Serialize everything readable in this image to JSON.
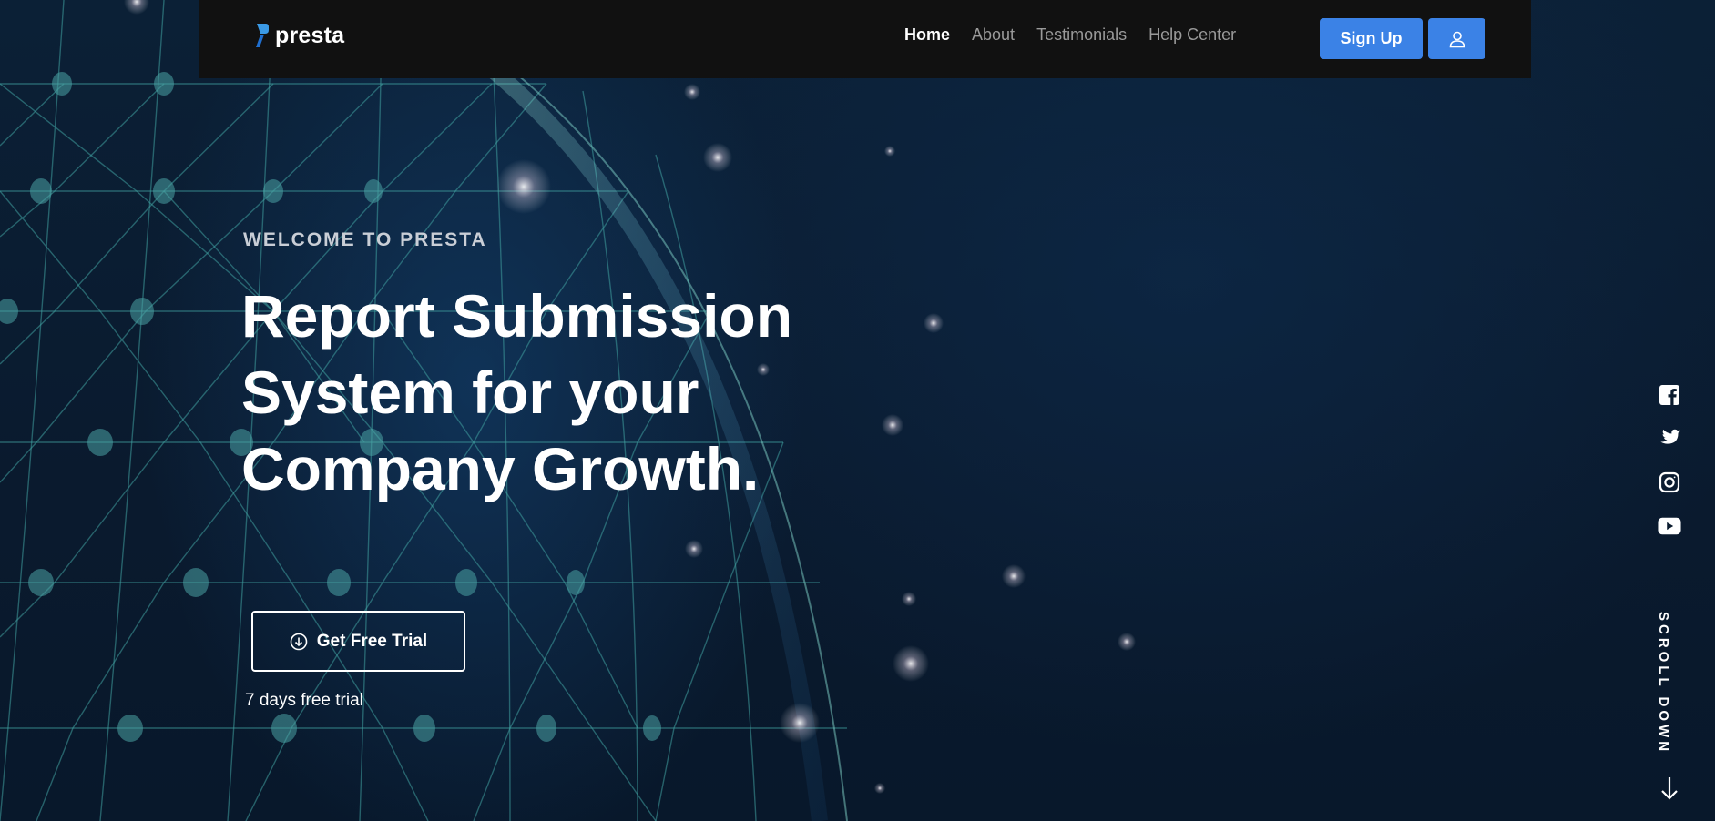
{
  "brand": {
    "name": "presta",
    "accent": "#3b82e6"
  },
  "nav": {
    "links": [
      {
        "label": "Home",
        "active": true
      },
      {
        "label": "About",
        "active": false
      },
      {
        "label": "Testimonials",
        "active": false
      },
      {
        "label": "Help Center",
        "active": false
      }
    ],
    "signup_label": "Sign Up",
    "user_icon": "user-icon"
  },
  "hero": {
    "eyebrow": "WELCOME TO PRESTA",
    "headline_lines": [
      "Report Submission",
      "System for your",
      "Company Growth."
    ],
    "cta_label": "Get Free Trial",
    "cta_icon": "download-circle-icon",
    "note": "7 days free trial"
  },
  "rail": {
    "social_icons": [
      "facebook-icon",
      "twitter-icon",
      "instagram-icon",
      "youtube-icon"
    ],
    "scroll_label": "SCROLL DOWN",
    "scroll_icon": "arrow-down-icon"
  }
}
